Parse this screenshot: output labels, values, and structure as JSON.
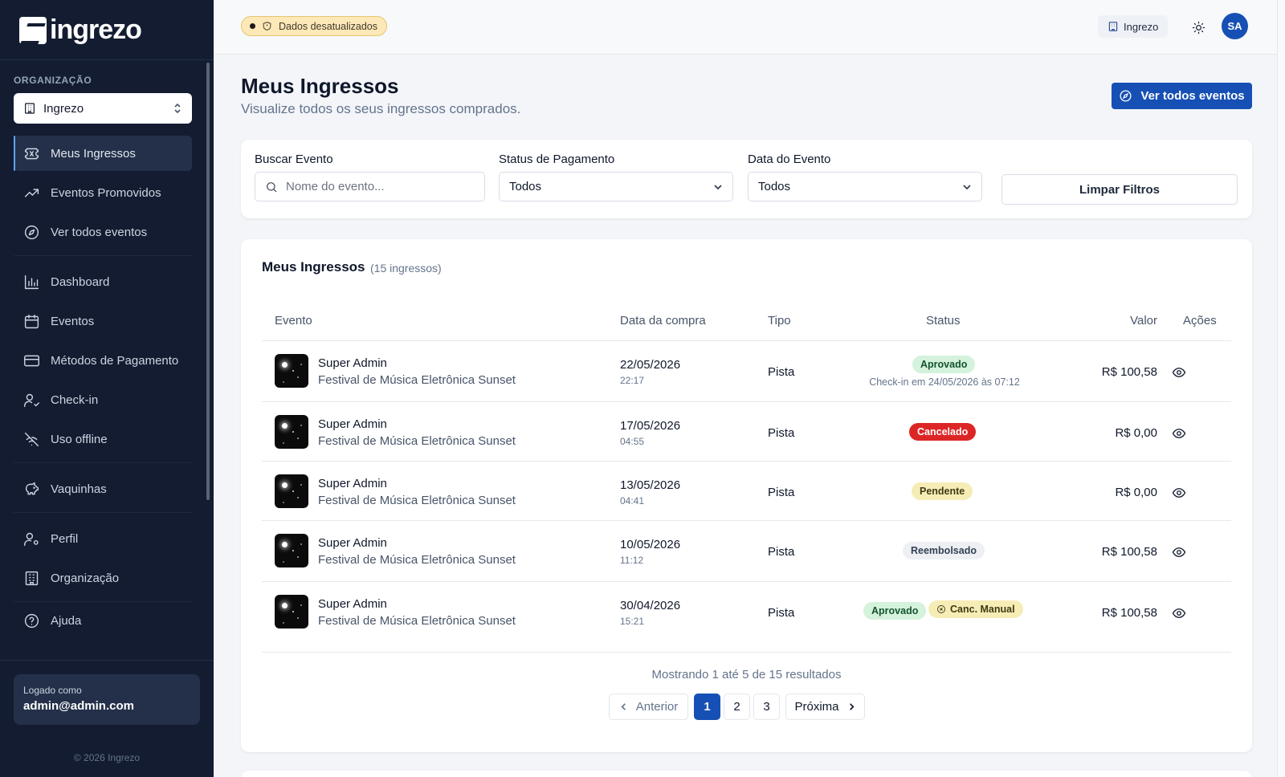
{
  "brand": {
    "name": "ingrezo"
  },
  "sidebar": {
    "org_label": "ORGANIZAÇÃO",
    "org_selected": "Ingrezo",
    "items": [
      {
        "label": "Meus Ingressos",
        "icon": "ticket-icon",
        "active": true
      },
      {
        "label": "Eventos Promovidos",
        "icon": "trending-up-icon"
      },
      {
        "label": "Ver todos eventos",
        "icon": "compass-icon"
      },
      {
        "label": "Dashboard",
        "icon": "bar-chart-icon"
      },
      {
        "label": "Eventos",
        "icon": "calendar-icon"
      },
      {
        "label": "Métodos de Pagamento",
        "icon": "credit-card-icon"
      },
      {
        "label": "Check-in",
        "icon": "user-check-icon"
      },
      {
        "label": "Uso offline",
        "icon": "wifi-off-icon"
      },
      {
        "label": "Vaquinhas",
        "icon": "piggy-bank-icon"
      },
      {
        "label": "Perfil",
        "icon": "user-cog-icon"
      },
      {
        "label": "Organização",
        "icon": "building-icon"
      },
      {
        "label": "Ajuda",
        "icon": "help-circle-icon"
      }
    ],
    "logged_as_label": "Logado como",
    "logged_as_email": "admin@admin.com",
    "copyright": "© 2026 Ingrezo"
  },
  "topbar": {
    "status_badge": "Dados desatualizados",
    "org_name": "Ingrezo",
    "avatar_initials": "SA"
  },
  "header": {
    "title": "Meus Ingressos",
    "subtitle": "Visualize todos os seus ingressos comprados.",
    "cta": "Ver todos eventos"
  },
  "filters": {
    "search_label": "Buscar Evento",
    "search_placeholder": "Nome do evento...",
    "payment_label": "Status de Pagamento",
    "payment_value": "Todos",
    "date_label": "Data do Evento",
    "date_value": "Todos",
    "clear_label": "Limpar Filtros"
  },
  "tickets": {
    "title": "Meus Ingressos",
    "count": "(15 ingressos)",
    "columns": {
      "event": "Evento",
      "purchase_date": "Data da compra",
      "type": "Tipo",
      "status": "Status",
      "value": "Valor",
      "actions": "Ações"
    },
    "rows": [
      {
        "name": "Super Admin",
        "event": "Festival de Música Eletrônica Sunset",
        "date": "22/05/2026",
        "time": "22:17",
        "type": "Pista",
        "status": "Aprovado",
        "checkin": "Check-in em 24/05/2026 às 07:12",
        "value": "R$ 100,58"
      },
      {
        "name": "Super Admin",
        "event": "Festival de Música Eletrônica Sunset",
        "date": "17/05/2026",
        "time": "04:55",
        "type": "Pista",
        "status": "Cancelado",
        "value": "R$ 0,00"
      },
      {
        "name": "Super Admin",
        "event": "Festival de Música Eletrônica Sunset",
        "date": "13/05/2026",
        "time": "04:41",
        "type": "Pista",
        "status": "Pendente",
        "value": "R$ 0,00"
      },
      {
        "name": "Super Admin",
        "event": "Festival de Música Eletrônica Sunset",
        "date": "10/05/2026",
        "time": "11:12",
        "type": "Pista",
        "status": "Reembolsado",
        "value": "R$ 100,58"
      },
      {
        "name": "Super Admin",
        "event": "Festival de Música Eletrônica Sunset",
        "date": "30/04/2026",
        "time": "15:21",
        "type": "Pista",
        "status": "Aprovado",
        "status2": "Canc. Manual",
        "value": "R$ 100,58"
      }
    ],
    "results_text": "Mostrando 1 até 5 de 15 resultados",
    "pagination": {
      "prev": "Anterior",
      "pages": [
        "1",
        "2",
        "3"
      ],
      "current": "1",
      "next": "Próxima"
    }
  },
  "colors": {
    "sidebar_bg": "#131c31",
    "primary": "#1650b4",
    "approved": "#d4f2dc",
    "cancelled": "#dc2626",
    "pending": "#f6edb6"
  }
}
